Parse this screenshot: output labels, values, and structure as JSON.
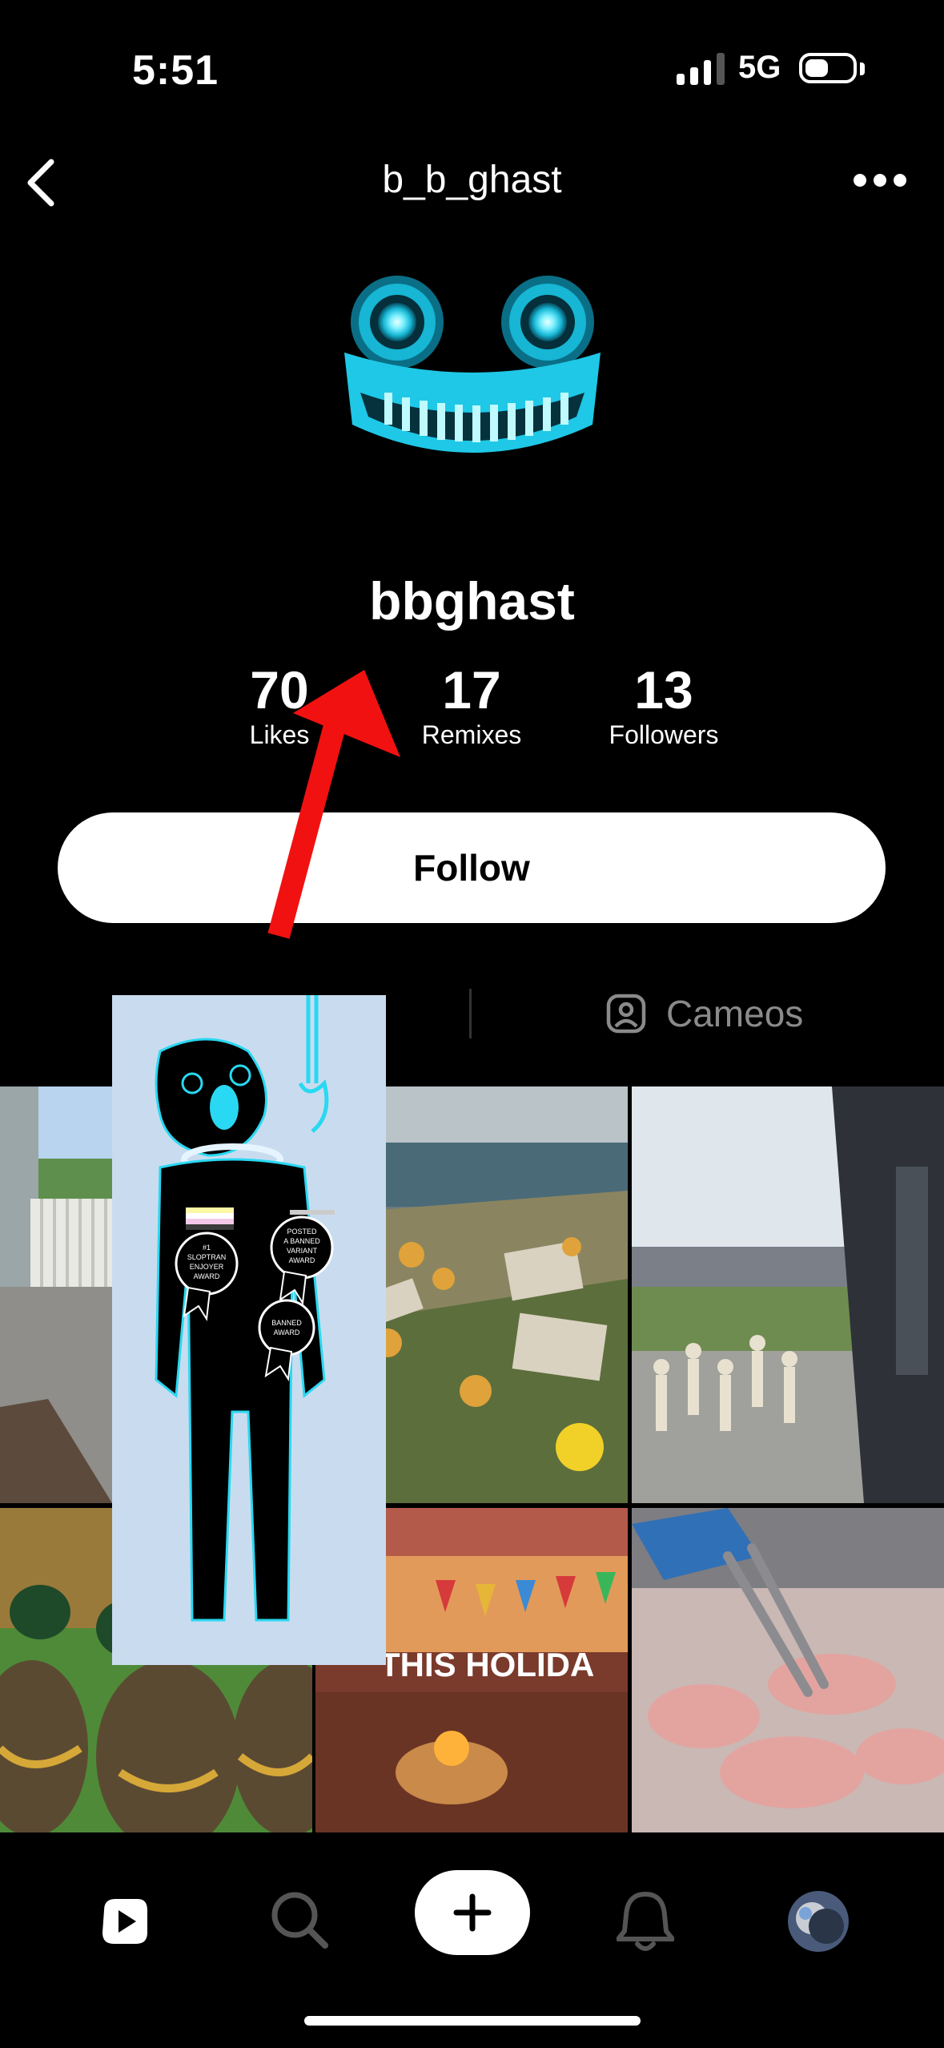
{
  "status_bar": {
    "time": "5:51",
    "network": "5G"
  },
  "header": {
    "username": "b_b_ghast"
  },
  "profile": {
    "display_name": "bbghast"
  },
  "stats": [
    {
      "value": "70",
      "label": "Likes"
    },
    {
      "value": "17",
      "label": "Remixes"
    },
    {
      "value": "13",
      "label": "Followers"
    }
  ],
  "follow_label": "Follow",
  "tabs": {
    "cameos_label": "Cameos"
  },
  "grid_overlay_text": "THIS HOLIDA",
  "meme": {
    "badge1": [
      "#1",
      "SLOPTRAN",
      "ENJOYER",
      "AWARD"
    ],
    "badge2": [
      "POSTED",
      "A BANNED",
      "VARIANT",
      "AWARD"
    ],
    "badge3": [
      "BANNED",
      "AWARD"
    ]
  },
  "colors": {
    "accent_cyan": "#29d8f2",
    "arrow_red": "#f21111"
  }
}
